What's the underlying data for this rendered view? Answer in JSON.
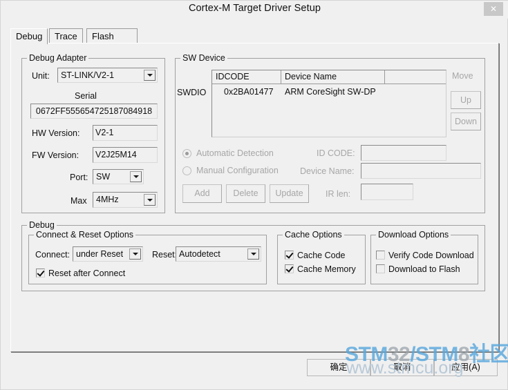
{
  "window": {
    "title": "Cortex-M Target Driver Setup",
    "close_label": "✕"
  },
  "tabs": [
    {
      "label": "Debug",
      "selected": true
    },
    {
      "label": "Trace",
      "selected": false
    },
    {
      "label": "Flash Download",
      "selected": false
    }
  ],
  "debug_adapter": {
    "legend": "Debug Adapter",
    "unit_label": "Unit:",
    "unit_value": "ST-LINK/V2-1",
    "serial_label": "Serial",
    "serial_value": "0672FF555654725187084918",
    "hw_version_label": "HW Version:",
    "hw_version_value": "V2-1",
    "fw_version_label": "FW Version:",
    "fw_version_value": "V2J25M14",
    "port_label": "Port:",
    "port_value": "SW",
    "max_label": "Max",
    "max_value": "4MHz"
  },
  "sw_device": {
    "legend": "SW Device",
    "swdio_label": "SWDIO",
    "columns": [
      "IDCODE",
      "Device Name",
      ""
    ],
    "rows": [
      {
        "idcode": "0x2BA01477",
        "device_name": "ARM CoreSight SW-DP",
        "extra": ""
      }
    ],
    "move_label": "Move",
    "up_label": "Up",
    "down_label": "Down",
    "automatic_detection_label": "Automatic Detection",
    "automatic_detection_selected": true,
    "manual_configuration_label": "Manual Configuration",
    "manual_configuration_selected": false,
    "id_code_label": "ID CODE:",
    "id_code_value": "",
    "device_name_label": "Device Name:",
    "device_name_value": "",
    "ir_len_label": "IR len:",
    "ir_len_value": "",
    "add_label": "Add",
    "delete_label": "Delete",
    "update_label": "Update"
  },
  "debug_group": {
    "legend": "Debug",
    "connect_reset": {
      "legend": "Connect & Reset Options",
      "connect_label": "Connect:",
      "connect_value": "under Reset",
      "reset_label": "Reset:",
      "reset_value": "Autodetect",
      "reset_after_connect_label": "Reset after Connect",
      "reset_after_connect_checked": true
    },
    "cache_options": {
      "legend": "Cache Options",
      "cache_code_label": "Cache Code",
      "cache_code_checked": true,
      "cache_memory_label": "Cache Memory",
      "cache_memory_checked": true
    },
    "download_options": {
      "legend": "Download Options",
      "verify_code_download_label": "Verify Code Download",
      "verify_code_download_checked": false,
      "download_to_flash_label": "Download to Flash",
      "download_to_flash_checked": false
    }
  },
  "dialog_buttons": {
    "ok_label": "确定",
    "cancel_label": "取消",
    "apply_label": "应用(A)"
  },
  "watermark": {
    "line1_a": "STM",
    "line1_b": "32",
    "line1_c": "/STM",
    "line1_d": "8",
    "line1_e": "社区",
    "line2": "www.stmcu.org",
    "blue": "#5aa8dd",
    "gray": "#9aa3ab"
  }
}
